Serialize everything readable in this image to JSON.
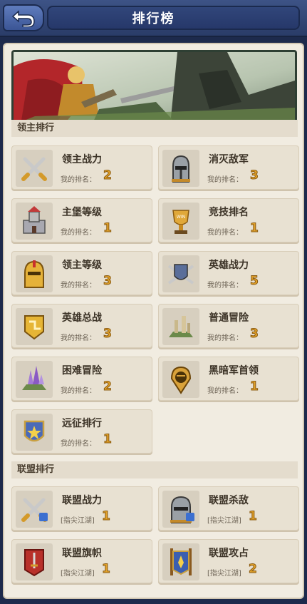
{
  "header": {
    "title": "排行榜"
  },
  "sections": {
    "lord_ranking": "领主排行",
    "alliance_ranking": "联盟排行"
  },
  "lord_cards": [
    {
      "label": "领主战力",
      "rank_label": "我的排名：",
      "rank": "2",
      "icon": "crossed-swords-icon"
    },
    {
      "label": "消灭敌军",
      "rank_label": "我的排名：",
      "rank": "3",
      "icon": "knight-helmet-icon"
    },
    {
      "label": "主堡等级",
      "rank_label": "我的排名：",
      "rank": "1",
      "icon": "castle-icon"
    },
    {
      "label": "竞技排名",
      "rank_label": "我的排名：",
      "rank": "1",
      "icon": "trophy-icon"
    },
    {
      "label": "领主等级",
      "rank_label": "我的排名：",
      "rank": "3",
      "icon": "gold-helmet-icon"
    },
    {
      "label": "英雄战力",
      "rank_label": "我的排名：",
      "rank": "5",
      "icon": "shield-swords-icon"
    },
    {
      "label": "英雄总战",
      "rank_label": "我的排名：",
      "rank": "3",
      "icon": "gold-badge-icon"
    },
    {
      "label": "普通冒险",
      "rank_label": "我的排名：",
      "rank": "3",
      "icon": "ruins-icon"
    },
    {
      "label": "困难冒险",
      "rank_label": "我的排名：",
      "rank": "2",
      "icon": "crystal-ruins-icon"
    },
    {
      "label": "黑暗军首领",
      "rank_label": "我的排名：",
      "rank": "1",
      "icon": "spartan-pin-icon"
    },
    {
      "label": "远征排行",
      "rank_label": "我的排名：",
      "rank": "1",
      "icon": "star-shield-icon"
    }
  ],
  "alliance_cards": [
    {
      "label": "联盟战力",
      "rank_label": "[指尖江湖]",
      "rank": "1",
      "icon": "alliance-swords-icon"
    },
    {
      "label": "联盟杀敌",
      "rank_label": "[指尖江湖]",
      "rank": "1",
      "icon": "alliance-helmet-icon"
    },
    {
      "label": "联盟旗帜",
      "rank_label": "[指尖江湖]",
      "rank": "1",
      "icon": "banner-sword-icon"
    },
    {
      "label": "联盟攻占",
      "rank_label": "[指尖江湖]",
      "rank": "2",
      "icon": "banner-crest-icon"
    }
  ],
  "colors": {
    "header_bg": "#2a3c68",
    "panel_bg": "#f1ece1",
    "card_bg": "#e8e1d2",
    "rank_gold": "#e2a22a"
  }
}
